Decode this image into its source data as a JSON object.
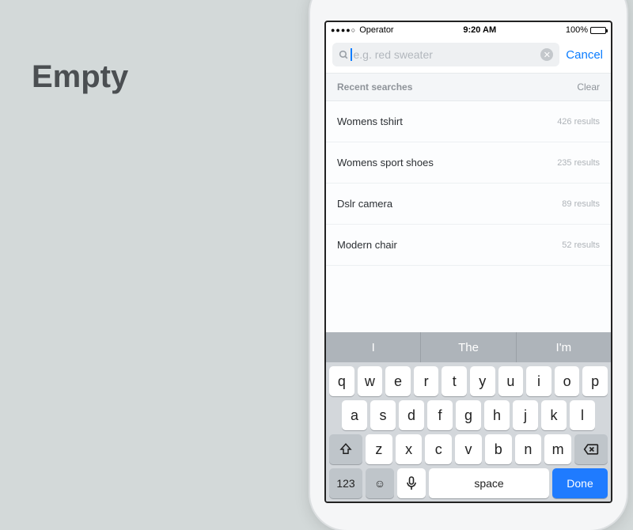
{
  "page_title": "Empty",
  "status": {
    "carrier": "Operator",
    "time": "9:20 AM",
    "battery": "100%"
  },
  "search": {
    "placeholder": "e.g. red sweater",
    "cancel": "Cancel"
  },
  "section": {
    "label": "Recent searches",
    "clear": "Clear"
  },
  "recent": [
    {
      "query": "Womens tshirt",
      "results": "426 results"
    },
    {
      "query": "Womens sport shoes",
      "results": "235 results"
    },
    {
      "query": "Dslr camera",
      "results": "89 results"
    },
    {
      "query": "Modern chair",
      "results": "52 results"
    }
  ],
  "keyboard": {
    "suggestions": [
      "I",
      "The",
      "I'm"
    ],
    "row1": [
      "q",
      "w",
      "e",
      "r",
      "t",
      "y",
      "u",
      "i",
      "o",
      "p"
    ],
    "row2": [
      "a",
      "s",
      "d",
      "f",
      "g",
      "h",
      "j",
      "k",
      "l"
    ],
    "row3": [
      "z",
      "x",
      "c",
      "v",
      "b",
      "n",
      "m"
    ],
    "numLabel": "123",
    "space": "space",
    "done": "Done"
  }
}
